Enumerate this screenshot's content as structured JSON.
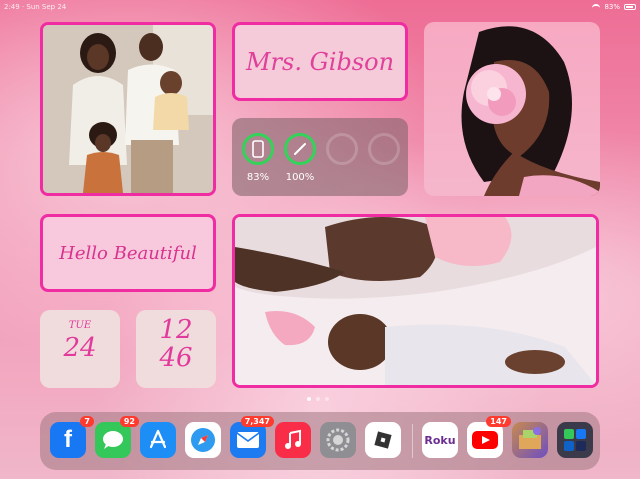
{
  "status_bar": {
    "time": "2:49 · Sun Sep 24",
    "battery": "83%"
  },
  "widgets": {
    "name_card": {
      "text": "Mrs. Gibson"
    },
    "hello_card": {
      "text": "Hello Beautiful"
    },
    "battery": {
      "items": [
        {
          "device": "ipad",
          "percent": "83%"
        },
        {
          "device": "pencil",
          "percent": "100%"
        }
      ]
    },
    "date": {
      "weekday": "TUE",
      "day": "24"
    },
    "clock": {
      "hour": "12",
      "minute": "46"
    }
  },
  "dock": {
    "apps": [
      {
        "name": "Facebook",
        "badge": "7",
        "color": "#1877f2"
      },
      {
        "name": "Messages",
        "badge": "92",
        "color": "#34c759"
      },
      {
        "name": "App Store",
        "badge": "",
        "color": "#1d8ef5"
      },
      {
        "name": "Safari",
        "badge": "",
        "color": "#2e9bf0"
      },
      {
        "name": "Mail",
        "badge": "7,347",
        "color": "#1d7bf2"
      },
      {
        "name": "Music",
        "badge": "",
        "color": "#fa2d48"
      },
      {
        "name": "Settings",
        "badge": "",
        "color": "#8e8e93"
      },
      {
        "name": "Roblox",
        "badge": "",
        "color": "#ffffff"
      },
      {
        "name": "Roku",
        "label": "Roku",
        "badge": "",
        "color": "#ffffff"
      },
      {
        "name": "YouTube",
        "badge": "147",
        "color": "#ffffff"
      },
      {
        "name": "Game",
        "badge": "",
        "color": "#7a5cc9"
      },
      {
        "name": "App Library",
        "badge": "",
        "color": "#3a3a4a"
      }
    ]
  }
}
